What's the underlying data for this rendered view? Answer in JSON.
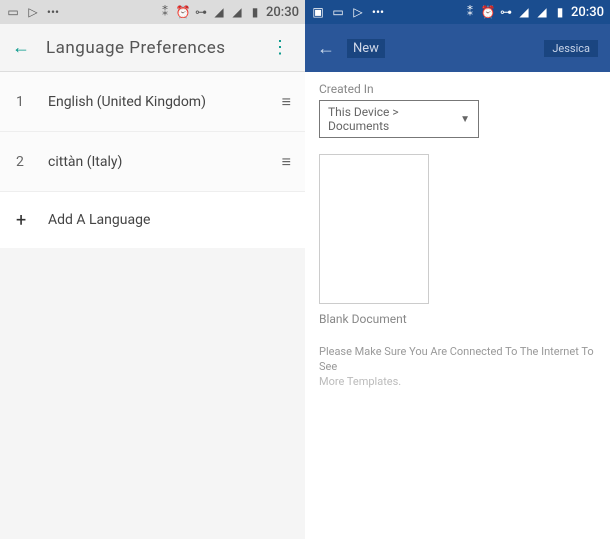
{
  "status": {
    "time": "20:30"
  },
  "left": {
    "title": "Language Preferences",
    "items": [
      {
        "num": "1",
        "name": "English (United Kingdom)"
      },
      {
        "num": "2",
        "name": "cittàn (Italy)"
      }
    ],
    "addLabel": "Add A Language"
  },
  "right": {
    "newLabel": "New",
    "userLabel": "Jessica",
    "createdIn": "Created In",
    "dropdown": "This Device > Documents",
    "blankDoc": "Blank Document",
    "internetMsg": "Please Make Sure You Are Connected To The Internet To See",
    "moreTemplates": "More Templates."
  }
}
